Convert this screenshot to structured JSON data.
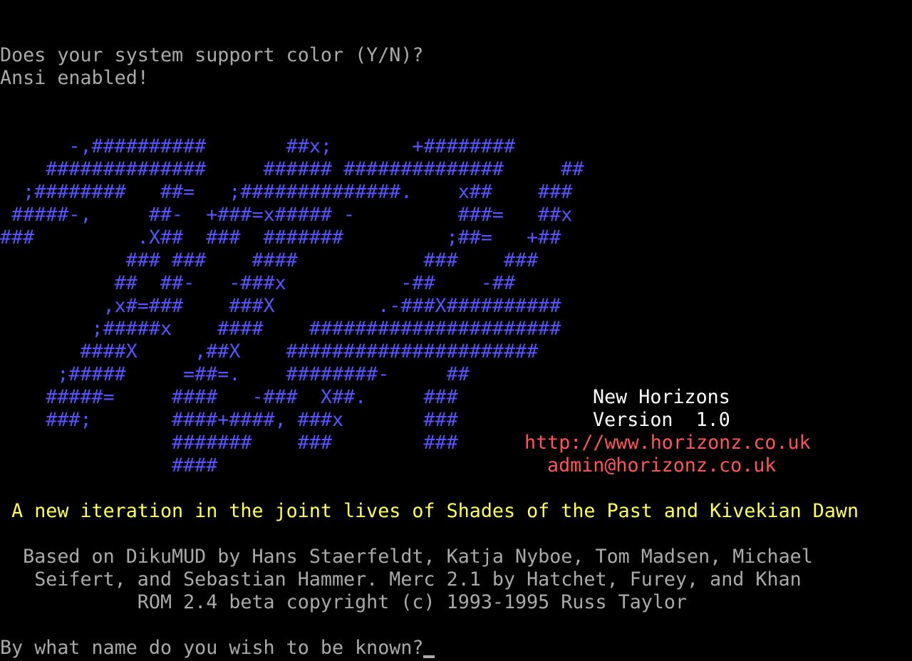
{
  "terminal": {
    "prompt_color": "Does your system support color (Y/N)?",
    "ansi_status": "Ansi enabled!",
    "logo_lines": [
      "      -,##########       ##x;       +########",
      "    ##############     ###### ##############     ##",
      "  ;########   ##=   ;##############.    x##    ###",
      " #####-,     ##-  +###=x##### -         ###=   ##x",
      "###         .X##  ###  #######         ;##=   +##",
      "           ### ###    ####           ###    ###",
      "          ##  ##-   -###x          -##    -##",
      "         ,x#=###    ###X         .-###X##########",
      "        ;#####x    ####    ######################",
      "       ####X     ,##X    ######################",
      "     ;#####     =##=.    ########-     ##",
      "    #####=     ####   -###  X##.     ###",
      "    ###;       ####+####, ###x       ###",
      "               #######    ###        ###",
      "               ####"
    ],
    "game_name": "New Horizons",
    "version": "Version  1.0",
    "website": "http://www.horizonz.co.uk",
    "email": "admin@horizonz.co.uk",
    "tagline": " A new iteration in the joint lives of Shades of the Past and Kivekian Dawn",
    "credits": [
      "  Based on DikuMUD by Hans Staerfeldt, Katja Nyboe, Tom Madsen, Michael",
      "   Seifert, and Sebastian Hammer. Merc 2.1 by Hatchet, Furey, and Khan",
      "            ROM 2.4 beta copyright (c) 1993-1995 Russ Taylor"
    ],
    "login_prompt": "By what name do you wish to be known?",
    "colors": {
      "background": "#000000",
      "default_text": "#aaaaaa",
      "logo": "#5555ff",
      "title": "#ffffff",
      "links": "#ff5555",
      "tagline": "#ffff55"
    }
  }
}
